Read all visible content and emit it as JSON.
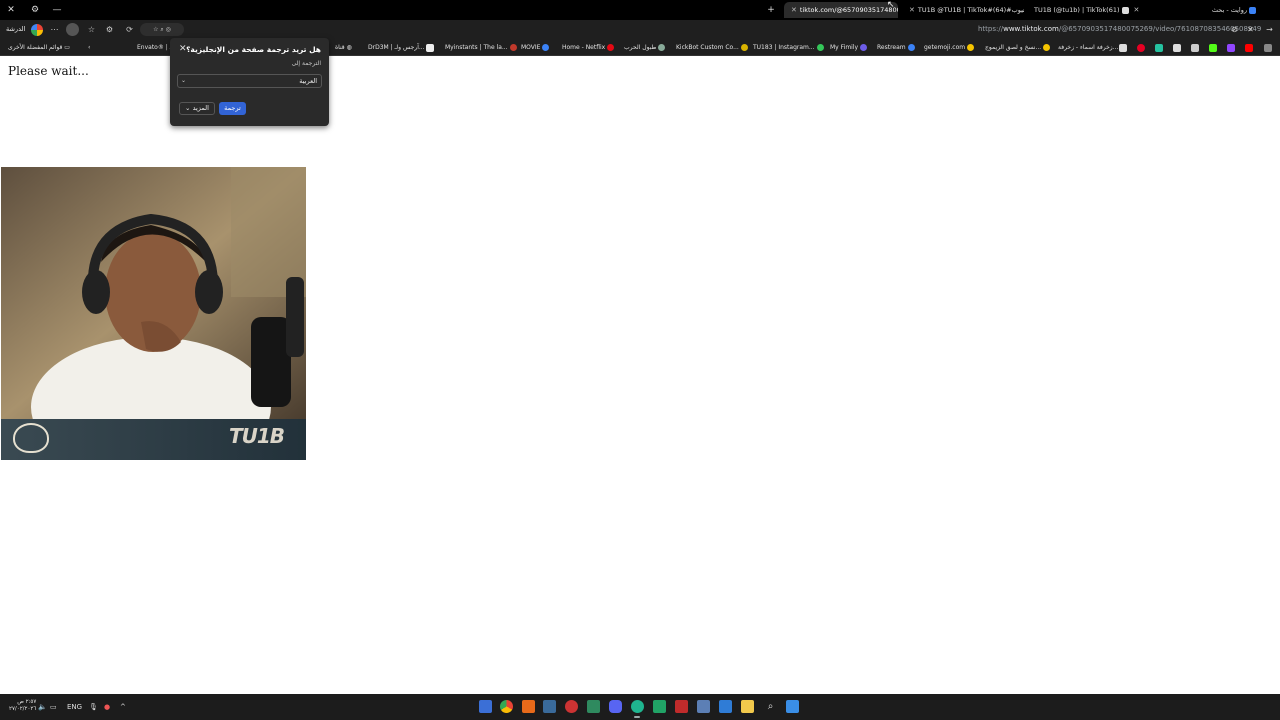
{
  "window": {
    "close_glyph": "✕",
    "settings_glyph": "⚙",
    "minimize_glyph": "—"
  },
  "tabs": [
    {
      "title": "tiktok.com/@6570903517480075",
      "active": true
    },
    {
      "title": "TU1B @TU1B | TikTok#التيوب#(64)",
      "active": false
    },
    {
      "title": "TU1B (@tu1b) | TikTok(61)",
      "active": false
    },
    {
      "title": "روايت - بحث",
      "active": false
    }
  ],
  "toolbar": {
    "profile_name": "الدرشة",
    "url_prefix": "https://",
    "url_domain": "www.tiktok.com",
    "url_path": "/@6570903517480075269/video/7610870835460508949"
  },
  "bookmarks": {
    "other_favorites": "قوائم المفضلة الأخرى",
    "items": [
      "Envato® | A",
      "قناة",
      "DrD3M | آرجس ولـ...",
      "Myinstants | The la...",
      "MOVIE",
      "Home - Netflix",
      "طبول الحرب",
      "KickBot Custom Co...",
      "TU183 | Instagram...",
      "My Fimily",
      "Restream",
      "getemoji.com",
      "نسخ و لصق الزيموج...",
      "زخرفة اسماء - زخرفة..."
    ]
  },
  "page": {
    "status_text": "Please wait...",
    "video_brand": "TU1B"
  },
  "translate_popup": {
    "title": "هل تريد ترجمة صفحة من الإنجليزية؟",
    "subtitle": "الترجمة إلى",
    "language_value": "العربية",
    "translate_button": "ترجمة",
    "more_button": "المزيد",
    "close_glyph": "✕"
  },
  "taskbar": {
    "time": "٢:٥٧ ص",
    "date": "٢٧/٠٢/٢٠٢٦",
    "language": "ENG"
  }
}
